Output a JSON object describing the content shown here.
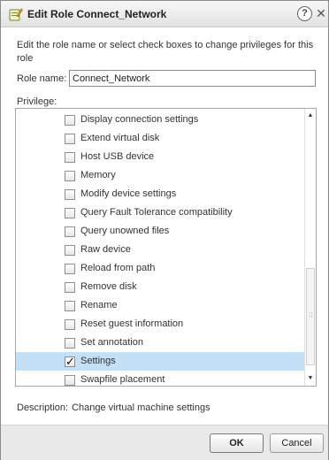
{
  "dialog": {
    "title": "Edit Role Connect_Network",
    "help_label": "?",
    "intro": "Edit the role name or select check boxes to change privileges for this role"
  },
  "role": {
    "label": "Role name:",
    "value": "Connect_Network"
  },
  "privilege": {
    "label": "Privilege:",
    "items": [
      {
        "label": "Display connection settings",
        "checked": false,
        "selected": false
      },
      {
        "label": "Extend virtual disk",
        "checked": false,
        "selected": false
      },
      {
        "label": "Host USB device",
        "checked": false,
        "selected": false
      },
      {
        "label": "Memory",
        "checked": false,
        "selected": false
      },
      {
        "label": "Modify device settings",
        "checked": false,
        "selected": false
      },
      {
        "label": "Query Fault Tolerance compatibility",
        "checked": false,
        "selected": false
      },
      {
        "label": "Query unowned files",
        "checked": false,
        "selected": false
      },
      {
        "label": "Raw device",
        "checked": false,
        "selected": false
      },
      {
        "label": "Reload from path",
        "checked": false,
        "selected": false
      },
      {
        "label": "Remove disk",
        "checked": false,
        "selected": false
      },
      {
        "label": "Rename",
        "checked": false,
        "selected": false
      },
      {
        "label": "Reset guest information",
        "checked": false,
        "selected": false
      },
      {
        "label": "Set annotation",
        "checked": false,
        "selected": false
      },
      {
        "label": "Settings",
        "checked": true,
        "selected": true
      },
      {
        "label": "Swapfile placement",
        "checked": false,
        "selected": false
      }
    ]
  },
  "description": {
    "label": "Description:",
    "value": "Change virtual machine settings"
  },
  "buttons": {
    "ok": "OK",
    "cancel": "Cancel"
  },
  "colors": {
    "selected_row": "#c3e0f7",
    "footer": "#e9e9e9"
  }
}
